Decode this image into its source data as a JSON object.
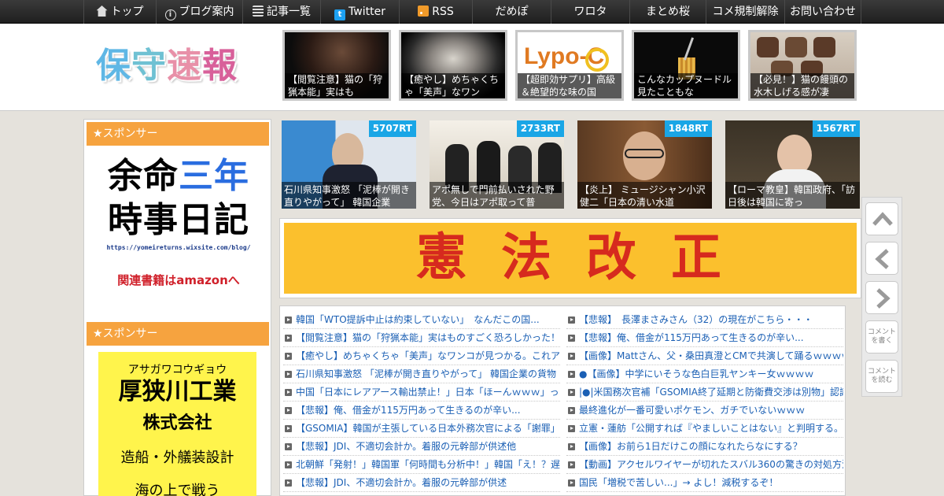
{
  "nav": {
    "items": [
      {
        "label": "トップ",
        "icon": "home-icon"
      },
      {
        "label": "ブログ案内",
        "icon": "info-icon"
      },
      {
        "label": "記事一覧",
        "icon": "list-icon"
      },
      {
        "label": "Twitter",
        "icon": "twitter-icon"
      },
      {
        "label": "RSS",
        "icon": "rss-icon"
      },
      {
        "label": "だめぽ"
      },
      {
        "label": "ワロタ"
      },
      {
        "label": "まとめ桜"
      },
      {
        "label": "コメ規制解除"
      },
      {
        "label": "お問い合わせ"
      }
    ]
  },
  "header": {
    "logo": [
      "保",
      "守",
      "速",
      "報"
    ],
    "thumbs": [
      {
        "caption": "【閲覧注意】猫の「狩猟本能」実はも"
      },
      {
        "caption": "【癒やし】めちゃくちゃ「美声」なワン"
      },
      {
        "caption": "【超即効サプリ】高級＆絶望的な味の国"
      },
      {
        "caption": "こんなカップヌードル見たこともな"
      },
      {
        "caption": "【必見！】猫の饅頭の水木しげる感が凄"
      }
    ]
  },
  "sidebar": {
    "heading1": "★スポンサー",
    "ad1": {
      "line1a": "余命",
      "line1b": "三年",
      "line2": "時事日記",
      "url": "https://yomeireturns.wixsite.com/blog/",
      "amazon": "関連書籍はamazonへ"
    },
    "heading2": "★スポンサー",
    "ad2": {
      "kana": "アサガワコウギョウ",
      "name": "厚狭川工業",
      "corp": "株式会社",
      "service": "造船・外艤装設計",
      "tail": "海の上で戦う"
    }
  },
  "featured": [
    {
      "rt": "5707RT",
      "caption": "石川県知事激怒 「泥棒が開き直りやがって」 韓国企業"
    },
    {
      "rt": "2733RT",
      "caption": "アポ無しで門前払いされた野党、今日はアポ取って普"
    },
    {
      "rt": "1848RT",
      "caption": "【炎上】 ミュージシャン小沢健二「日本の清い水道"
    },
    {
      "rt": "1567RT",
      "caption": "【ローマ教皇】韓国政府、「訪日後は韓国に寄っ"
    }
  ],
  "banner": {
    "text": "憲法改正"
  },
  "articles": {
    "left": [
      "韓国「WTO提訴中止は約束していない」　なんだこの国...",
      "【閲覧注意】猫の「狩猟本能」実はものすごく恐ろしかった！",
      "【癒やし】めちゃくちゃ「美声」なワンコが見つかる。これア",
      "石川県知事激怒 「泥棒が開き直りやがって」 韓国企業の貨物",
      "中国「日本にレアアース輸出禁止！」日本「ほーんｗｗｗ」っ",
      "【悲報】俺、借金が115万円あって生きるのが辛い...",
      "【GSOMIA】韓国が主張している日本外務次官による「謝罪」発",
      "【悲報】JDI、不適切会計か。着服の元幹部が供述他",
      "北朝鮮「発射！」韓国軍「何時間も分析中！」韓国「え！？遅",
      "【悲報】JDI、不適切会計か。着服の元幹部が供述"
    ],
    "right": [
      "【悲報】　長澤まさみさん（32）の現在がこちら・・・",
      "【悲報】俺、借金が115万円あって生きるのが辛い...",
      "【画像】Mattさん、父・桑田真澄とCMで共演して踊るｗｗｗｗ",
      "●【画像】中学にいそうな色白巨乳ヤンキー女ｗｗｗｗ",
      "|●|米国務次官補「GSOMIA終了延期と防衛費交渉は別物」認識",
      "最終進化が一番可愛いポケモン、ガチでいないｗｗｗ",
      "立憲・蓮舫「公開すれば『やましいことはない』と判明する。",
      "【画像】お前ら1日だけこの顔になれたらなにする？",
      "【動画】アクセルワイヤーが切れたスバル360の驚きの対処方法",
      "国民「増税で苦しい...」→ よし！減税するぞ！"
    ]
  },
  "float": {
    "comment_write": "コメントを書く",
    "comment_read": "コメントを読む"
  }
}
